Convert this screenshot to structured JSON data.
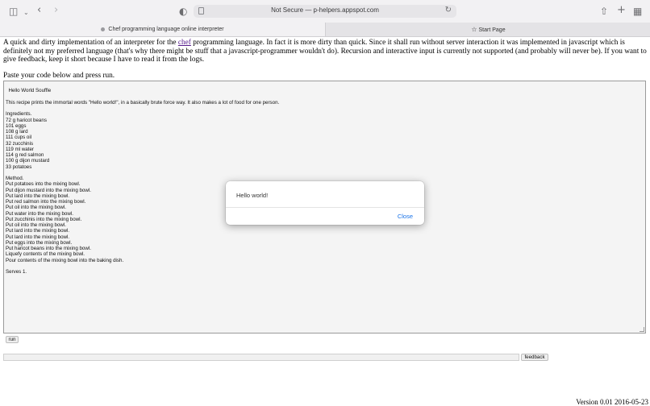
{
  "browser": {
    "url": "Not Secure — p-helpers.appspot.com",
    "tabs": [
      {
        "label": "Chef programming language online interpreter"
      },
      {
        "label": "Start Page"
      }
    ]
  },
  "page": {
    "intro_before_link": "A quick and dirty implementation of an interpreter for the ",
    "intro_link": "chef",
    "intro_after_link": " programming language. In fact it is more dirty than quick. Since it shall run without server interaction it was implemented in javascript which is definitely not my preferred language (that's why there might be stuff that a javascript-programmer wouldn't do). Recursion and interactive input is currently not supported (and probably will never be). If you want to give feedback, keep it short because I have to read it from the logs.",
    "paste_instruction": "Paste your code below and press run.",
    "code": "Hello World Souffle\n\nThis recipe prints the immortal words \"Hello world!\", in a basically brute force way. It also makes a lot of food for one person.\n\nIngredients.\n72 g haricot beans\n101 eggs\n108 g lard\n111 cups oil\n32 zucchinis\n119 ml water\n114 g red salmon\n100 g dijon mustard\n33 potatoes\n\nMethod.\nPut potatoes into the mixing bowl.\nPut dijon mustard into the mixing bowl.\nPut lard into the mixing bowl.\nPut red salmon into the mixing bowl.\nPut oil into the mixing bowl.\nPut water into the mixing bowl.\nPut zucchinis into the mixing bowl.\nPut oil into the mixing bowl.\nPut lard into the mixing bowl.\nPut lard into the mixing bowl.\nPut eggs into the mixing bowl.\nPut haricot beans into the mixing bowl.\nLiquefy contents of the mixing bowl.\nPour contents of the mixing bowl into the baking dish.\n\nServes 1.",
    "run_label": "run",
    "feedback_value": "",
    "feedback_label": "feedback",
    "version": "Version 0.01 2016-05-23"
  },
  "dialog": {
    "message": "Hello world!",
    "close_label": "Close"
  },
  "icons": [
    "sidebar-icon",
    "chevron-down-icon",
    "back-icon",
    "forward-icon",
    "shield-icon",
    "page-icon",
    "reload-icon",
    "share-icon",
    "plus-icon",
    "tab-overview-icon",
    "star-icon"
  ]
}
